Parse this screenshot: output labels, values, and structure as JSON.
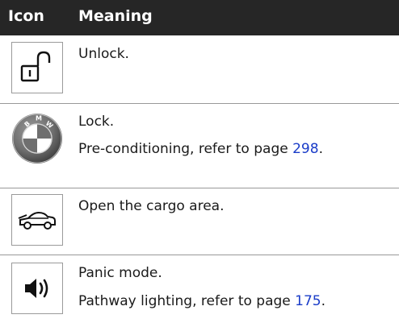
{
  "header": {
    "icon_col": "Icon",
    "meaning_col": "Meaning"
  },
  "rows": [
    {
      "icon": "unlock-padlock-icon",
      "lines": [
        {
          "text": "Unlock."
        }
      ]
    },
    {
      "icon": "bmw-logo-icon",
      "lines": [
        {
          "text": "Lock."
        },
        {
          "text": "Pre-conditioning, refer to page ",
          "link": "298",
          "suffix": "."
        }
      ]
    },
    {
      "icon": "car-trunk-icon",
      "lines": [
        {
          "text": "Open the cargo area."
        }
      ]
    },
    {
      "icon": "speaker-sound-icon",
      "lines": [
        {
          "text": "Panic mode."
        },
        {
          "text": "Pathway lighting, refer to page ",
          "link": "175",
          "suffix": "."
        }
      ]
    }
  ],
  "colors": {
    "header_bg": "#262626",
    "link": "#1a3cc8",
    "divider": "#999999"
  }
}
